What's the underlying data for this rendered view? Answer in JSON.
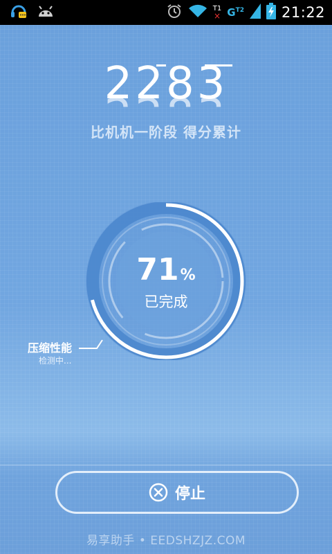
{
  "status_bar": {
    "time": "21:22",
    "network_label": "G",
    "network_sup": "T2",
    "sim_label": "T1",
    "sim_mark": "×",
    "icons": [
      "headset-chat-icon",
      "android-icon",
      "alarm-icon",
      "wifi-icon",
      "no-sim-icon",
      "signal-icon",
      "battery-charging-icon"
    ]
  },
  "score": {
    "value": "2283",
    "caption": "比机机一阶段 得分累计"
  },
  "progress": {
    "percent_value": "71",
    "percent_unit": "%",
    "fraction": 0.71,
    "status_label": "已完成"
  },
  "current_test": {
    "name": "压缩性能",
    "status": "检测中..."
  },
  "actions": {
    "stop_label": "停止",
    "stop_icon": "close-circle-icon"
  },
  "footer": {
    "watermark": "易享助手 • EEDSHZJZ.COM"
  },
  "colors": {
    "background": "#6fa3dd",
    "ring_dark": "#4a86cc",
    "ring_progress": "#ffffff",
    "status_accent": "#35b5e5"
  }
}
